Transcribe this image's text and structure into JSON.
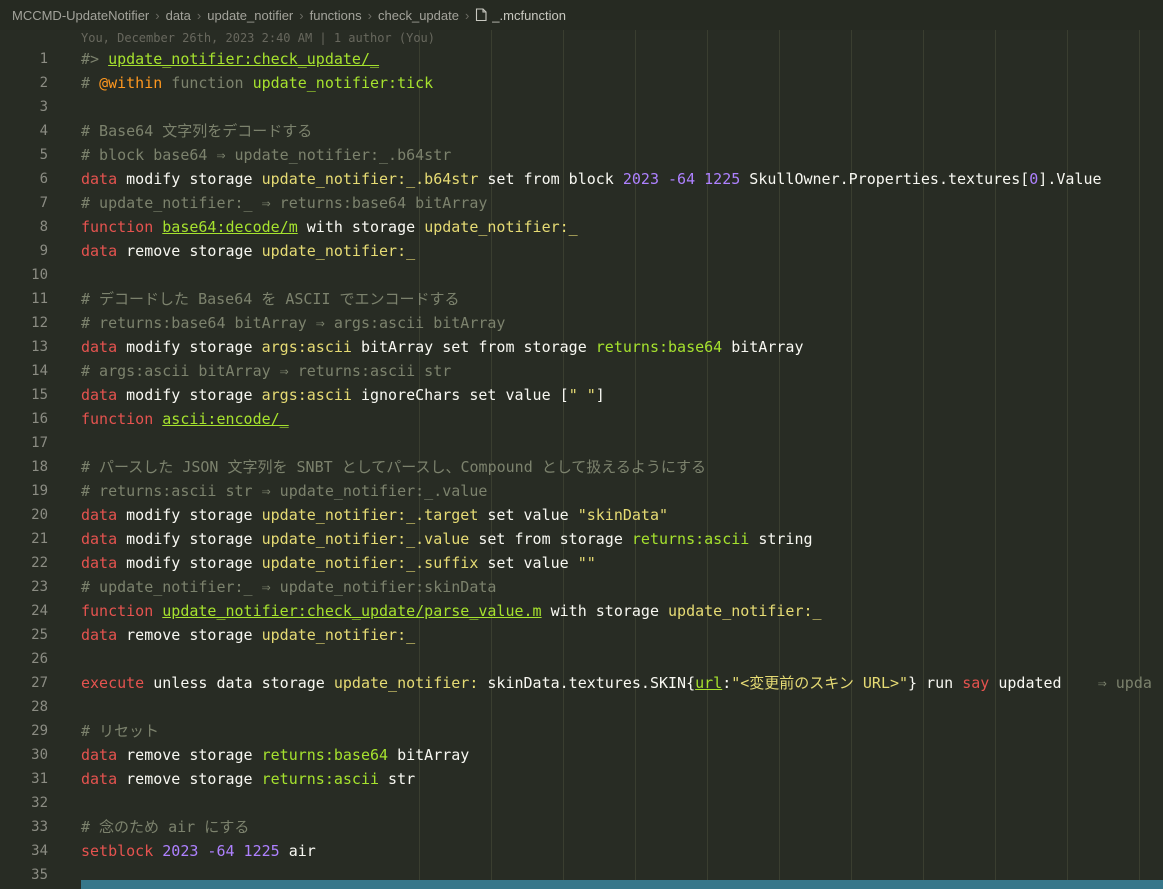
{
  "breadcrumb": {
    "items": [
      "MCCMD-UpdateNotifier",
      "data",
      "update_notifier",
      "functions",
      "check_update"
    ],
    "separator": "›",
    "file": "_.mcfunction"
  },
  "blame": {
    "text": "You, December 26th, 2023 2:40 AM | 1 author (You)"
  },
  "colors": {
    "background": "#282c24",
    "command_red": "#e5534f",
    "literal_white": "#f8f8f2",
    "storage_yellow": "#e6db74",
    "link_green": "#a6e22e",
    "number_purple": "#ae81ff",
    "comment_gray": "#7c826d",
    "annotation_orange": "#fd971f",
    "scrollbar_teal": "#37778a"
  },
  "editor": {
    "lines": [
      {
        "n": "1",
        "t": [
          [
            "cmt",
            "#> "
          ],
          [
            "link",
            "update_notifier:check_update/_"
          ]
        ]
      },
      {
        "n": "2",
        "t": [
          [
            "cmt",
            "# "
          ],
          [
            "ann",
            "@within"
          ],
          [
            "cmt",
            " function "
          ],
          [
            "nsg",
            "update_notifier:tick"
          ]
        ]
      },
      {
        "n": "3",
        "t": []
      },
      {
        "n": "4",
        "t": [
          [
            "cmt",
            "# Base64 文字列をデコードする"
          ]
        ]
      },
      {
        "n": "5",
        "t": [
          [
            "cmt",
            "# block base64 ⇒ update_notifier:_.b64str"
          ]
        ]
      },
      {
        "n": "6",
        "t": [
          [
            "cmd",
            "data"
          ],
          [
            "txt",
            " modify storage "
          ],
          [
            "nsy",
            "update_notifier:_.b64str"
          ],
          [
            "txt",
            " set from block "
          ],
          [
            "num",
            "2023 -64 1225"
          ],
          [
            "txt",
            " SkullOwner.Properties.textures["
          ],
          [
            "num",
            "0"
          ],
          [
            "txt",
            "].Value"
          ]
        ]
      },
      {
        "n": "7",
        "t": [
          [
            "cmt",
            "# update_notifier:_ ⇒ returns:base64 bitArray"
          ]
        ]
      },
      {
        "n": "8",
        "t": [
          [
            "cmd",
            "function"
          ],
          [
            "txt",
            " "
          ],
          [
            "link",
            "base64:decode/m"
          ],
          [
            "txt",
            " with storage "
          ],
          [
            "nsy",
            "update_notifier:_"
          ]
        ]
      },
      {
        "n": "9",
        "t": [
          [
            "cmd",
            "data"
          ],
          [
            "txt",
            " remove storage "
          ],
          [
            "nsy",
            "update_notifier:_"
          ]
        ]
      },
      {
        "n": "10",
        "t": []
      },
      {
        "n": "11",
        "t": [
          [
            "cmt",
            "# デコードした Base64 を ASCII でエンコードする"
          ]
        ]
      },
      {
        "n": "12",
        "t": [
          [
            "cmt",
            "# returns:base64 bitArray ⇒ args:ascii bitArray"
          ]
        ]
      },
      {
        "n": "13",
        "t": [
          [
            "cmd",
            "data"
          ],
          [
            "txt",
            " modify storage "
          ],
          [
            "nsy",
            "args:ascii"
          ],
          [
            "txt",
            " bitArray set from storage "
          ],
          [
            "nsg",
            "returns:base64"
          ],
          [
            "txt",
            " bitArray"
          ]
        ]
      },
      {
        "n": "14",
        "t": [
          [
            "cmt",
            "# args:ascii bitArray ⇒ returns:ascii str"
          ]
        ]
      },
      {
        "n": "15",
        "t": [
          [
            "cmd",
            "data"
          ],
          [
            "txt",
            " modify storage "
          ],
          [
            "nsy",
            "args:ascii"
          ],
          [
            "txt",
            " ignoreChars set value ["
          ],
          [
            "str",
            "\" \""
          ],
          [
            "txt",
            "]"
          ]
        ]
      },
      {
        "n": "16",
        "t": [
          [
            "cmd",
            "function"
          ],
          [
            "txt",
            " "
          ],
          [
            "link",
            "ascii:encode/_"
          ]
        ]
      },
      {
        "n": "17",
        "t": []
      },
      {
        "n": "18",
        "t": [
          [
            "cmt",
            "# パースした JSON 文字列を SNBT としてパースし、Compound として扱えるようにする"
          ]
        ]
      },
      {
        "n": "19",
        "t": [
          [
            "cmt",
            "# returns:ascii str ⇒ update_notifier:_.value"
          ]
        ]
      },
      {
        "n": "20",
        "t": [
          [
            "cmd",
            "data"
          ],
          [
            "txt",
            " modify storage "
          ],
          [
            "nsy",
            "update_notifier:_.target"
          ],
          [
            "txt",
            " set value "
          ],
          [
            "str",
            "\"skinData\""
          ]
        ]
      },
      {
        "n": "21",
        "t": [
          [
            "cmd",
            "data"
          ],
          [
            "txt",
            " modify storage "
          ],
          [
            "nsy",
            "update_notifier:_.value"
          ],
          [
            "txt",
            " set from storage "
          ],
          [
            "nsg",
            "returns:ascii"
          ],
          [
            "txt",
            " string"
          ]
        ]
      },
      {
        "n": "22",
        "t": [
          [
            "cmd",
            "data"
          ],
          [
            "txt",
            " modify storage "
          ],
          [
            "nsy",
            "update_notifier:_.suffix"
          ],
          [
            "txt",
            " set value "
          ],
          [
            "str",
            "\"\""
          ]
        ]
      },
      {
        "n": "23",
        "t": [
          [
            "cmt",
            "# update_notifier:_ ⇒ update_notifier:skinData"
          ]
        ]
      },
      {
        "n": "24",
        "t": [
          [
            "cmd",
            "function"
          ],
          [
            "txt",
            " "
          ],
          [
            "link",
            "update_notifier:check_update/parse_value.m"
          ],
          [
            "txt",
            " with storage "
          ],
          [
            "nsy",
            "update_notifier:_"
          ]
        ]
      },
      {
        "n": "25",
        "t": [
          [
            "cmd",
            "data"
          ],
          [
            "txt",
            " remove storage "
          ],
          [
            "nsy",
            "update_notifier:_"
          ]
        ]
      },
      {
        "n": "26",
        "t": []
      },
      {
        "n": "27",
        "t": [
          [
            "cmd",
            "execute"
          ],
          [
            "txt",
            " unless data storage "
          ],
          [
            "nsy",
            "update_notifier:"
          ],
          [
            "txt",
            " skinData.textures.SKIN{"
          ],
          [
            "url",
            "url"
          ],
          [
            "txt",
            ":"
          ],
          [
            "str",
            "\"<変更前のスキン URL>\""
          ],
          [
            "txt",
            "} run "
          ],
          [
            "cmd",
            "say"
          ],
          [
            "txt",
            " updated    "
          ],
          [
            "cmt",
            "⇒ upda"
          ]
        ]
      },
      {
        "n": "28",
        "t": []
      },
      {
        "n": "29",
        "t": [
          [
            "cmt",
            "# リセット"
          ]
        ]
      },
      {
        "n": "30",
        "t": [
          [
            "cmd",
            "data"
          ],
          [
            "txt",
            " remove storage "
          ],
          [
            "nsg",
            "returns:base64"
          ],
          [
            "txt",
            " bitArray"
          ]
        ]
      },
      {
        "n": "31",
        "t": [
          [
            "cmd",
            "data"
          ],
          [
            "txt",
            " remove storage "
          ],
          [
            "nsg",
            "returns:ascii"
          ],
          [
            "txt",
            " str"
          ]
        ]
      },
      {
        "n": "32",
        "t": []
      },
      {
        "n": "33",
        "t": [
          [
            "cmt",
            "# 念のため air にする"
          ]
        ]
      },
      {
        "n": "34",
        "t": [
          [
            "cmd",
            "setblock"
          ],
          [
            "txt",
            " "
          ],
          [
            "num",
            "2023 -64 1225"
          ],
          [
            "txt",
            " air"
          ]
        ]
      },
      {
        "n": "35",
        "t": []
      }
    ]
  }
}
